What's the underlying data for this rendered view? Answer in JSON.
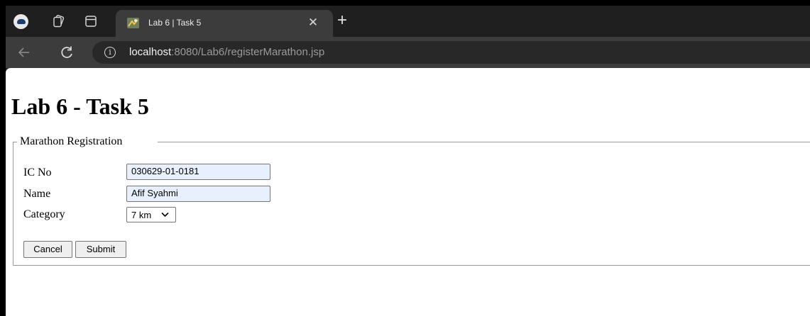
{
  "browser": {
    "tab": {
      "title": "Lab 6 | Task 5",
      "favicon": "lab-favicon-icon"
    },
    "address": {
      "host": "localhost",
      "path": ":8080/Lab6/registerMarathon.jsp"
    },
    "icons": {
      "profile": "profile-avatar-icon",
      "workspaces": "workspaces-icon",
      "tab_actions": "tab-actions-icon",
      "back": "back-arrow-icon",
      "reload": "reload-icon",
      "site_info": "info-icon",
      "new_tab": "plus-icon",
      "close_tab": "close-icon"
    },
    "new_tab_glyph": "+",
    "close_tab_glyph": "✕",
    "site_info_glyph": "i"
  },
  "page": {
    "heading": "Lab 6 - Task 5",
    "form": {
      "legend": "Marathon Registration",
      "fields": {
        "ic_no": {
          "label": "IC No",
          "value": "030629-01-0181"
        },
        "name": {
          "label": "Name",
          "value": "Afif Syahmi"
        },
        "category": {
          "label": "Category",
          "value": "7 km"
        }
      },
      "buttons": {
        "cancel": "Cancel",
        "submit": "Submit"
      }
    }
  }
}
